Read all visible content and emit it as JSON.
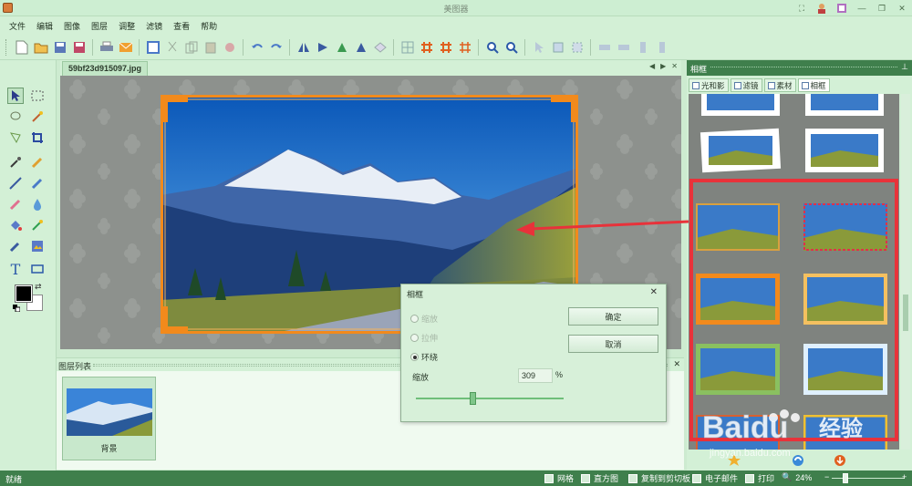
{
  "window": {
    "title": "美图器"
  },
  "menu": [
    "文件",
    "编辑",
    "图像",
    "图层",
    "调整",
    "滤镜",
    "查看",
    "帮助"
  ],
  "document": {
    "tab_name": "59bf23d915097.jpg"
  },
  "layers": {
    "title": "图层列表",
    "items": [
      {
        "name": "背景"
      }
    ]
  },
  "right_panel": {
    "title": "相框",
    "tabs": [
      {
        "label": "光和影",
        "active": false
      },
      {
        "label": "滤镜",
        "active": false
      },
      {
        "label": "素材",
        "active": false
      },
      {
        "label": "相框",
        "active": true
      }
    ]
  },
  "dialog": {
    "title": "相框",
    "options": [
      {
        "label": "缩放",
        "checked": false,
        "enabled": false
      },
      {
        "label": "拉伸",
        "checked": false,
        "enabled": false
      },
      {
        "label": "环绕",
        "checked": true,
        "enabled": true
      }
    ],
    "ok_label": "确定",
    "cancel_label": "取消",
    "scale_label": "缩放",
    "scale_value": "309",
    "scale_unit": "%"
  },
  "status": {
    "ready": "就绪",
    "grid": "网格",
    "histogram": "直方图",
    "copy_clipboard": "复制到剪切板",
    "email": "电子邮件",
    "print": "打印",
    "zoom": "24%"
  },
  "watermark": {
    "brand": "Baidu",
    "brand_cn": "经验",
    "url": "jingyan.baidu.com"
  },
  "colors": {
    "accent_green": "#3f7f4c",
    "highlight_red": "#e8323a",
    "ui_green": "#d3f0d6"
  }
}
